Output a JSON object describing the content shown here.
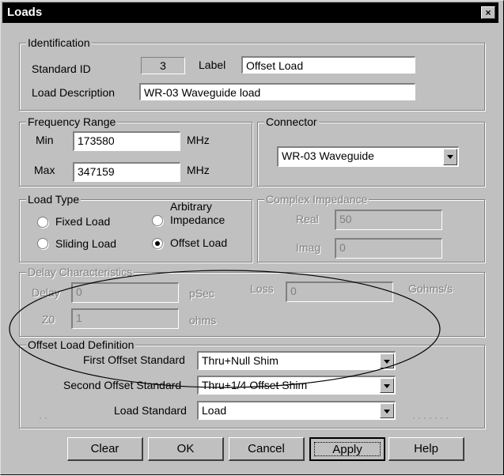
{
  "window": {
    "title": "Loads",
    "close_glyph": "×"
  },
  "identification": {
    "legend": "Identification",
    "standard_id_label": "Standard ID",
    "standard_id_value": "3",
    "label_label": "Label",
    "label_value": "Offset Load",
    "description_label": "Load Description",
    "description_value": "WR-03 Waveguide  load"
  },
  "frequency": {
    "legend": "Frequency Range",
    "min_label": "Min",
    "min_value": "173580",
    "max_label": "Max",
    "max_value": "347159",
    "unit_min": "MHz",
    "unit_max": "MHz"
  },
  "connector": {
    "legend": "Connector",
    "value": "WR-03 Waveguide"
  },
  "load_type": {
    "legend": "Load Type",
    "options": [
      {
        "label": "Fixed Load",
        "selected": false
      },
      {
        "label": "Sliding Load",
        "selected": false
      },
      {
        "label": "Arbitrary",
        "label2": "Impedance",
        "selected": false
      },
      {
        "label": "Offset Load",
        "selected": true
      }
    ]
  },
  "complex_impedance": {
    "legend": "Complex Impedance",
    "real_label": "Real",
    "real_value": "50",
    "imag_label": "Imag",
    "imag_value": "0"
  },
  "delay": {
    "legend": "Delay Characteristics",
    "delay_label": "Delay",
    "delay_value": "0",
    "delay_unit": "pSec",
    "loss_label": "Loss",
    "loss_value": "0",
    "loss_unit": "Gohms/s",
    "z0_label": "Z0",
    "z0_value": "1",
    "z0_unit": "ohms"
  },
  "offset": {
    "legend": "Offset Load Definition",
    "first_label": "First Offset Standard",
    "first_value": "Thru+Null Shim",
    "second_label": "Second Offset Standard",
    "second_value": "Thru+1/4 Offset Shim",
    "load_label": "Load Standard",
    "load_value": "Load"
  },
  "buttons": {
    "clear": "Clear",
    "ok": "OK",
    "cancel": "Cancel",
    "apply": "Apply",
    "help": "Help"
  },
  "colors": {
    "face": "#c0c0c0",
    "disabled_text": "#808080",
    "titlebar": "#000000"
  }
}
